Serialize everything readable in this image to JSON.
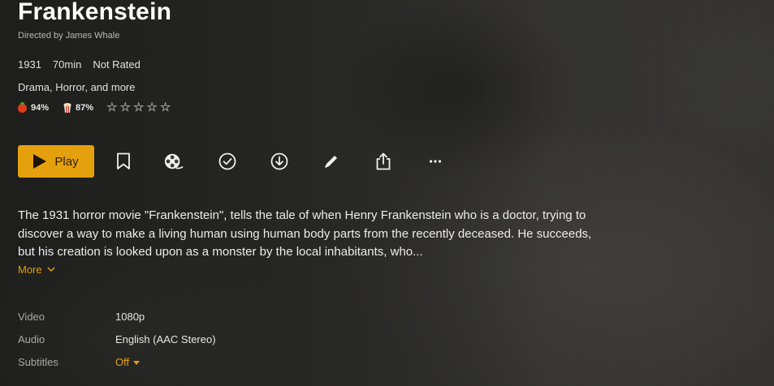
{
  "movie": {
    "title": "Frankenstein",
    "director_line": "Directed by James Whale",
    "year": "1931",
    "duration": "70min",
    "content_rating": "Not Rated",
    "genres": "Drama, Horror, and more",
    "ratings": {
      "critic_score": "94%",
      "audience_score": "87%",
      "user_stars_filled": 0,
      "user_stars_total": 5
    },
    "summary": "The 1931 horror movie \"Frankenstein\", tells the tale of when Henry Frankenstein who is a doctor, trying to discover a way to make a living human using human body parts from the recently deceased. He succeeds, but his creation is looked upon as a monster by the local inhabitants, who...",
    "more_label": "More"
  },
  "actions": {
    "play_label": "Play",
    "icons": [
      "bookmark-icon",
      "film-reel-icon",
      "check-circle-icon",
      "download-icon",
      "pencil-icon",
      "share-icon",
      "more-icon"
    ]
  },
  "details": {
    "video_label": "Video",
    "video_value": "1080p",
    "audio_label": "Audio",
    "audio_value": "English (AAC Stereo)",
    "subtitles_label": "Subtitles",
    "subtitles_value": "Off"
  },
  "colors": {
    "accent": "#e5a00d",
    "critic_tomato": "#e03b1f"
  }
}
